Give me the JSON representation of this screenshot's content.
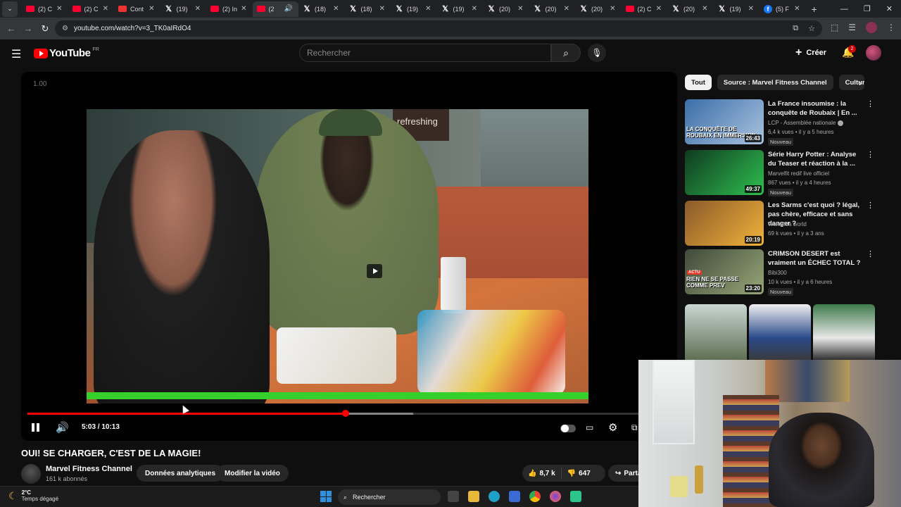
{
  "browser": {
    "tabs": [
      {
        "title": "(2) C",
        "icon": "youtube-favicon",
        "active": false
      },
      {
        "title": "(2) C",
        "icon": "youtube-favicon",
        "active": false
      },
      {
        "title": "Cont",
        "icon": "contact-favicon",
        "active": false
      },
      {
        "title": "(19) ",
        "icon": "x-favicon",
        "active": false
      },
      {
        "title": "(2) In",
        "icon": "youtube-favicon",
        "active": false
      },
      {
        "title": "(2",
        "icon": "youtube-favicon",
        "active": true
      },
      {
        "title": "(18) ",
        "icon": "x-favicon",
        "active": false
      },
      {
        "title": "(18) ",
        "icon": "x-favicon",
        "active": false
      },
      {
        "title": "(19) ",
        "icon": "x-favicon",
        "active": false
      },
      {
        "title": "(19) ",
        "icon": "x-favicon",
        "active": false
      },
      {
        "title": "(20) ",
        "icon": "x-favicon",
        "active": false
      },
      {
        "title": "(20) ",
        "icon": "x-favicon",
        "active": false
      },
      {
        "title": "(20) ",
        "icon": "x-favicon",
        "active": false
      },
      {
        "title": "(2) C",
        "icon": "youtube-favicon",
        "active": false
      },
      {
        "title": "(20) ",
        "icon": "x-favicon",
        "active": false
      },
      {
        "title": "(19) ",
        "icon": "x-favicon",
        "active": false
      },
      {
        "title": "(5) F",
        "icon": "facebook-favicon",
        "active": false
      }
    ],
    "url": "youtube.com/watch?v=3_TK0aIRdO4"
  },
  "yt_header": {
    "logo_text": "YouTube",
    "country": "FR",
    "search_placeholder": "Rechercher",
    "create_label": "Créer",
    "notification_count": "2"
  },
  "player": {
    "speed_label": "1.00",
    "current_time": "5:03",
    "duration": "10:13",
    "time_text": "5:03 / 10:13",
    "played_fraction": 0.494,
    "buffered_fraction": 0.6,
    "frame_sign": "refreshing sp"
  },
  "video": {
    "title": "OUI! SE CHARGER, C'EST DE LA MAGIE!",
    "channel_name": "Marvel Fitness Channel",
    "subscribers": "161 k abonnés",
    "analytics_label": "Données analytiques",
    "edit_label": "Modifier la vidéo",
    "likes": "8,7 k",
    "dislikes": "647",
    "share_label": "Partager"
  },
  "sidebar": {
    "chips": [
      "Tout",
      "Source : Marvel Fitness Channel",
      "Culture"
    ],
    "recommendations": [
      {
        "title": "La France insoumise : la conquête de Roubaix | En ...",
        "channel": "LCP - Assemblée nationale",
        "verified": true,
        "meta": "6,4 k vues • il y a 5 heures",
        "badge": "Nouveau",
        "duration": "26:43",
        "thumb_text": "LA CONQUÊTE DE ROUBAIX EN IMMERSION",
        "thumb_colors": [
          "#3b6ea8",
          "#a9c3df"
        ]
      },
      {
        "title": "Série Harry Potter : Analyse du Teaser et réaction à la ...",
        "channel": "Marvelfit redif live officiel",
        "verified": false,
        "meta": "867 vues • il y a 4 heures",
        "badge": "Nouveau",
        "duration": "49:37",
        "thumb_text": "",
        "thumb_colors": [
          "#0f3a20",
          "#2fbf4f"
        ]
      },
      {
        "title": "Les Sarms c'est quoi ? légal, pas chère, efficace et sans danger ?",
        "channel": "Wakanda world",
        "verified": false,
        "meta": "69 k vues • il y a 3 ans",
        "badge": "",
        "duration": "20:19",
        "thumb_text": "",
        "thumb_colors": [
          "#8a5a2a",
          "#f2b23a"
        ]
      },
      {
        "title": "CRIMSON DESERT est vraiment un ÉCHEC TOTAL ?",
        "channel": "Bibi300",
        "verified": false,
        "meta": "10 k vues • il y a 6 heures",
        "badge": "Nouveau",
        "duration": "23:20",
        "thumb_text": "RIEN NE SE PASSE COMME PREV",
        "tag": "ACTU",
        "thumb_colors": [
          "#3f4a3a",
          "#98a678"
        ]
      }
    ]
  },
  "taskbar": {
    "temperature": "2°C",
    "weather": "Temps dégagé",
    "search_label": "Rechercher"
  },
  "colors": {
    "yt_red": "#ff0000",
    "background": "#0f0f0f",
    "chip_bg": "#272727"
  }
}
